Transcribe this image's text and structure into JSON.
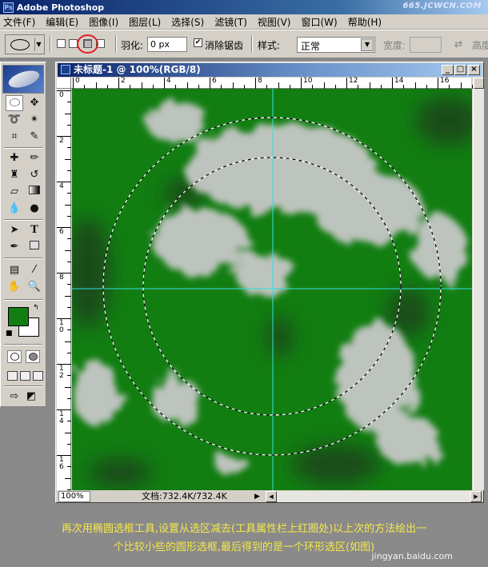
{
  "app": {
    "title": "Adobe Photoshop",
    "watermark": "665.JCWCN.COM"
  },
  "menu": [
    "文件(F)",
    "编辑(E)",
    "图像(I)",
    "图层(L)",
    "选择(S)",
    "滤镜(T)",
    "视图(V)",
    "窗口(W)",
    "帮助(H)"
  ],
  "options": {
    "selection_mode_highlighted": "从选区减去",
    "feather_label": "羽化:",
    "feather_value": "0 px",
    "antialias_label": "消除锯齿",
    "antialias_checked": "✔",
    "style_label": "样式:",
    "style_value": "正常",
    "width_label": "宽度:",
    "height_label": "高度",
    "swap_icon": "⇄"
  },
  "document": {
    "title": "未标题-1 @ 100%(RGB/8)",
    "zoom": "100%",
    "doc_info": "文档:732.4K/732.4K",
    "ruler_h_labels": [
      "0",
      "2",
      "4",
      "6",
      "8",
      "10",
      "12",
      "14",
      "16"
    ],
    "ruler_v_labels": [
      "0",
      "2",
      "4",
      "6",
      "8",
      "10",
      "12",
      "14",
      "16"
    ],
    "colors": {
      "canvas_green": "#127e12",
      "cloud": "#c8c8c8",
      "guide": "#31e0e0"
    }
  },
  "toolbox": {
    "tools": [
      "marquee-tool",
      "move-tool",
      "lasso-tool",
      "magic-wand-tool",
      "crop-tool",
      "slice-tool",
      "healing-brush-tool",
      "brush-tool",
      "clone-stamp-tool",
      "history-brush-tool",
      "eraser-tool",
      "gradient-tool",
      "blur-tool",
      "dodge-tool",
      "path-selection-tool",
      "type-tool",
      "pen-tool",
      "shape-tool",
      "notes-tool",
      "eyedropper-tool",
      "hand-tool",
      "zoom-tool"
    ],
    "foreground_color": "#127e12",
    "background_color": "#ffffff"
  },
  "caption": {
    "line1": "再次用椭圆选框工具,设置从选区减去(工具属性栏上红圈处)以上次的方法绘出一",
    "line2": "个比较小些的圆形选框,最后得到的是一个环形选区(如图)",
    "watermark": "jingyan.baidu.com"
  }
}
